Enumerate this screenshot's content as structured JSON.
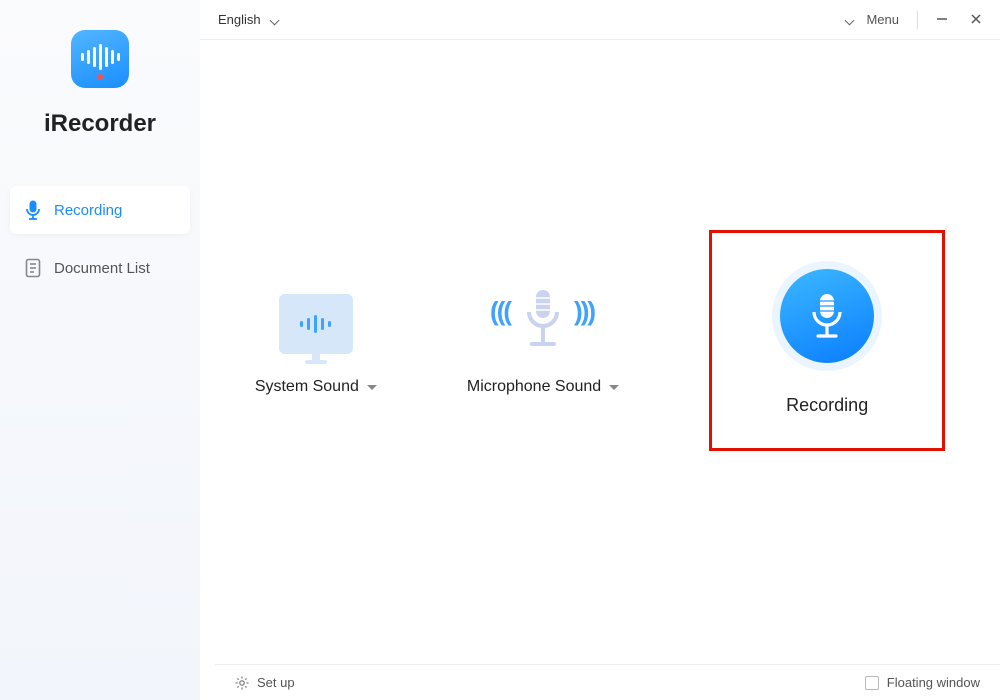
{
  "app": {
    "name": "iRecorder"
  },
  "topbar": {
    "language": "English",
    "menu_label": "Menu"
  },
  "sidebar": {
    "items": [
      {
        "label": "Recording",
        "icon": "mic-icon",
        "active": true
      },
      {
        "label": "Document List",
        "icon": "document-icon",
        "active": false
      }
    ]
  },
  "main": {
    "options": {
      "system_sound_label": "System Sound",
      "microphone_sound_label": "Microphone Sound",
      "recording_label": "Recording"
    }
  },
  "bottombar": {
    "setup_label": "Set up",
    "floating_window_label": "Floating window"
  },
  "colors": {
    "accent": "#1a8eff",
    "highlight_border": "#e31000"
  }
}
